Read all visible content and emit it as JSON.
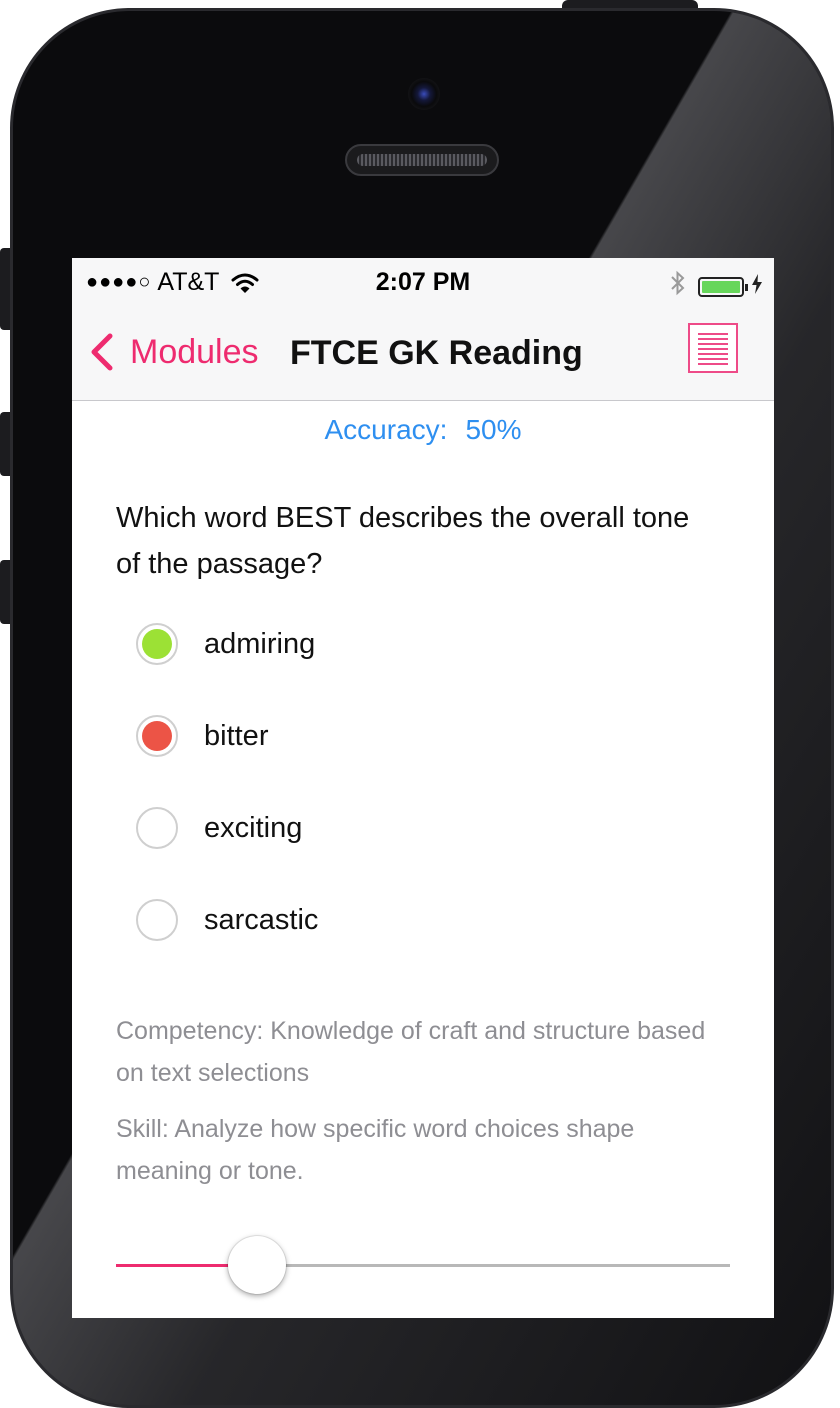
{
  "status_bar": {
    "signal": "●●●●○",
    "carrier": "AT&T",
    "time": "2:07 PM",
    "bluetooth_icon": "bluetooth-icon",
    "battery_level": 1.0
  },
  "nav": {
    "back_label": "Modules",
    "title": "FTCE GK Reading",
    "list_icon": "list-icon"
  },
  "accuracy": {
    "label": "Accuracy:",
    "value": "50%"
  },
  "question": "Which word BEST describes the overall tone of the passage?",
  "options": [
    {
      "label": "admiring",
      "state": "correct",
      "color": "#9ce135"
    },
    {
      "label": "bitter",
      "state": "incorrect",
      "color": "#ec5446"
    },
    {
      "label": "exciting",
      "state": "none",
      "color": ""
    },
    {
      "label": "sarcastic",
      "state": "none",
      "color": ""
    }
  ],
  "competency": "Competency: Knowledge of craft and structure based on text selections",
  "skill": "Skill: Analyze how specific word choices shape meaning or tone.",
  "progress": {
    "fraction": 0.23
  },
  "colors": {
    "accent": "#ee2b6f",
    "accuracy": "#2e8ff0",
    "secondary_text": "#8e8e93"
  }
}
